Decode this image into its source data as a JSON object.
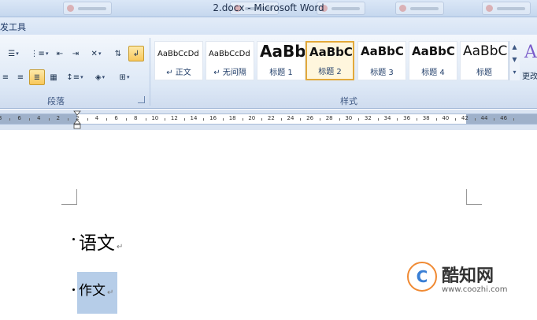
{
  "window": {
    "title": "2.docx - Microsoft Word"
  },
  "ribbon": {
    "context_tab": "发工具",
    "groups": {
      "paragraph_label": "段落",
      "styles_label": "样式"
    },
    "styles": [
      {
        "sample": "AaBbCcDd",
        "name": "↵ 正文",
        "selected": false
      },
      {
        "sample": "AaBbCcDd",
        "name": "↵ 无间隔",
        "selected": false
      },
      {
        "sample": "AaBb",
        "name": "标题 1",
        "selected": false
      },
      {
        "sample": "AaBbC",
        "name": "标题 2",
        "selected": true
      },
      {
        "sample": "AaBbC",
        "name": "标题 3",
        "selected": false
      },
      {
        "sample": "AaBbC",
        "name": "标题 4",
        "selected": false
      },
      {
        "sample": "AaBbC",
        "name": "标题",
        "selected": false
      }
    ],
    "more_styles_label": "更改"
  },
  "ruler": {
    "ticks": [
      "8",
      "6",
      "4",
      "2",
      "2",
      "4",
      "6",
      "8",
      "10",
      "12",
      "14",
      "16",
      "18",
      "20",
      "22",
      "24",
      "26",
      "28",
      "30",
      "32",
      "34",
      "36",
      "38",
      "40",
      "42",
      "44",
      "46"
    ]
  },
  "document": {
    "lines": [
      {
        "text": "语文",
        "selected": false
      },
      {
        "text": "作文",
        "selected": true
      }
    ],
    "paragraph_mark": "↵"
  },
  "watermark": {
    "name": "酷知网",
    "url": "www.coozhi.com"
  },
  "colors": {
    "selection": "#b6cde8",
    "selected_style_border": "#e3a93a",
    "ribbon_bg": "#dde8f6"
  }
}
